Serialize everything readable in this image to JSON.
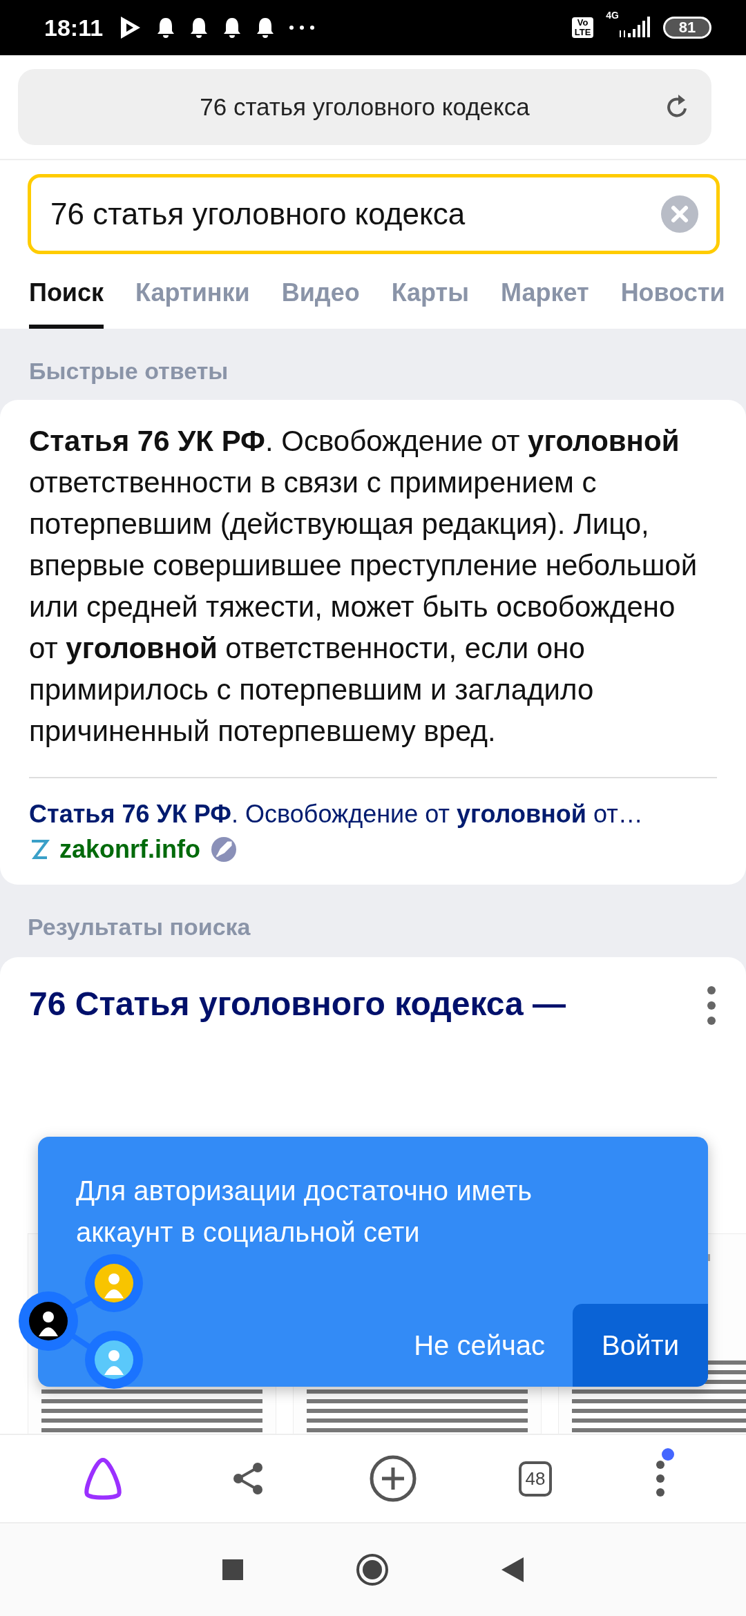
{
  "status_bar": {
    "time": "18:11",
    "volte": [
      "Vo",
      "LTE"
    ],
    "network": "4G",
    "battery": "81"
  },
  "address_bar": {
    "text": "76 статья уголовного кодекса"
  },
  "search": {
    "value": "76 статья уголовного кодекса"
  },
  "tabs": [
    {
      "label": "Поиск",
      "selected": true
    },
    {
      "label": "Картинки",
      "selected": false
    },
    {
      "label": "Видео",
      "selected": false
    },
    {
      "label": "Карты",
      "selected": false
    },
    {
      "label": "Маркет",
      "selected": false
    },
    {
      "label": "Новости",
      "selected": false
    }
  ],
  "quick_answers": {
    "heading": "Быстрые ответы",
    "text": "**Статья 76 УК РФ**. Освобождение от **уголовной** ответственности в связи с примирением с потерпевшим (действующая редакция). Лицо, впервые совершившее преступление небольшой или средней тяжести, может быть освобождено от **уголовной** ответственности, если оно примирилось с потерпевшим и загладило причиненный потерпевшему вред.",
    "source_title": "**Статья 76 УК РФ**. Освобождение от **уголовной** от…",
    "source_site": "zakonrf.info"
  },
  "results": {
    "heading": "Результаты поиска",
    "items": [
      {
        "title": "76 Статья уголовного кодекса —"
      }
    ]
  },
  "popup": {
    "text": "Для авторизации достаточно иметь аккаунт в социальной сети",
    "buttons": [
      {
        "label": "Не сейчас",
        "kind": "text"
      },
      {
        "label": "Войти",
        "kind": "primary"
      }
    ]
  },
  "bottom_bar": {
    "tabs_count": "48",
    "menu_badge": true
  }
}
